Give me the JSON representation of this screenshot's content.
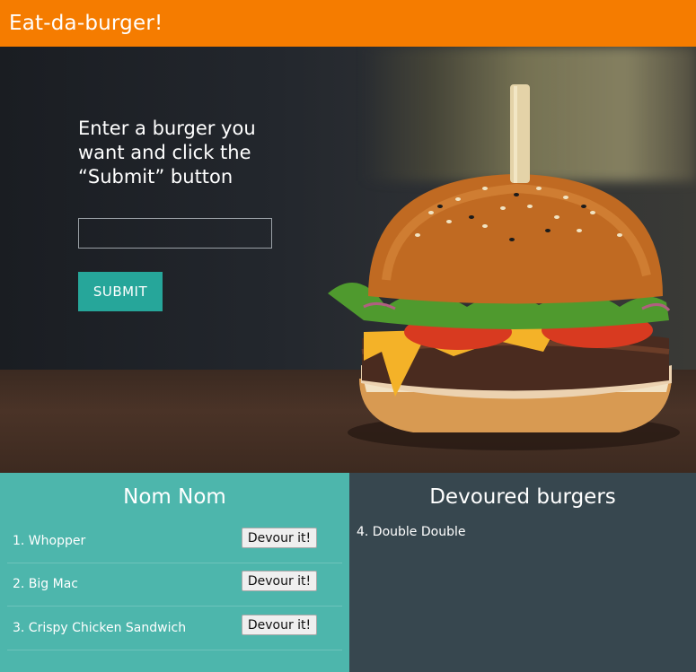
{
  "navbar": {
    "brand": "Eat-da-burger!"
  },
  "hero": {
    "title": "Enter a burger you want and click the “Submit” button",
    "input": {
      "value": "",
      "placeholder": ""
    },
    "submit_label": "SUBMIT"
  },
  "nom_nom": {
    "title": "Nom Nom",
    "items": [
      {
        "label": "1. Whopper",
        "button": "Devour it!"
      },
      {
        "label": "2. Big Mac",
        "button": "Devour it!"
      },
      {
        "label": "3. Crispy Chicken Sandwich",
        "button": "Devour it!"
      }
    ]
  },
  "devoured": {
    "title": "Devoured burgers",
    "items": [
      {
        "label": "4. Double Double"
      }
    ]
  },
  "colors": {
    "navbar": "#f57c00",
    "submit": "#26a69a",
    "nom_nom_panel": "#4db6ac",
    "devoured_panel": "#37474f"
  }
}
